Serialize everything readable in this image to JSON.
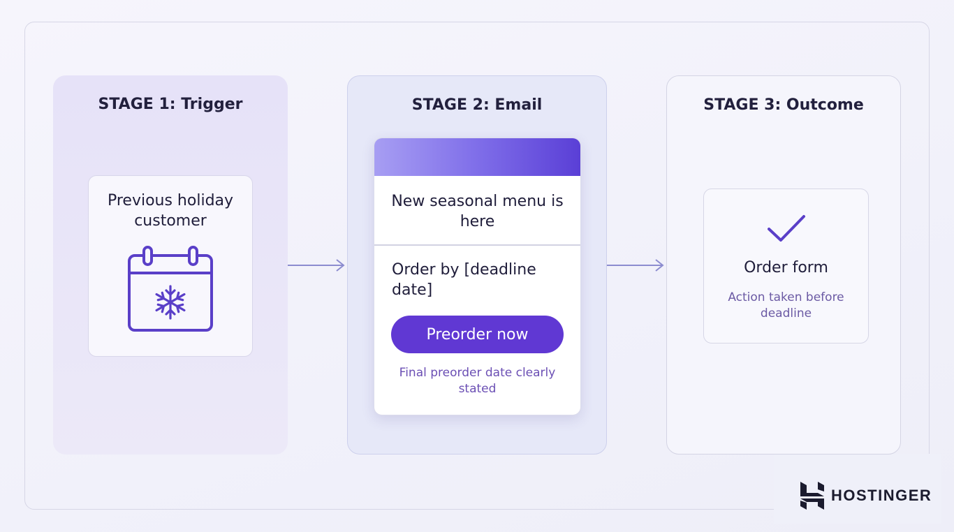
{
  "stages": [
    {
      "title": "STAGE 1: Trigger",
      "card_text": "Previous holiday customer",
      "icon": "calendar-snowflake-icon"
    },
    {
      "title": "STAGE 2: Email",
      "email": {
        "subject": "New seasonal menu is here",
        "order_text": "Order by [deadline date]",
        "button_label": "Preorder now",
        "note": "Final preorder date clearly stated"
      }
    },
    {
      "title": "STAGE 3: Outcome",
      "card_title": "Order form",
      "card_note": "Action taken before deadline",
      "icon": "checkmark-icon"
    }
  ],
  "brand": {
    "name": "HOSTINGER",
    "icon": "hostinger-logo-icon"
  },
  "colors": {
    "accent": "#6038d3",
    "text": "#1f1d3a",
    "note": "#6b4fb4",
    "arrow": "#8c8ccf"
  }
}
